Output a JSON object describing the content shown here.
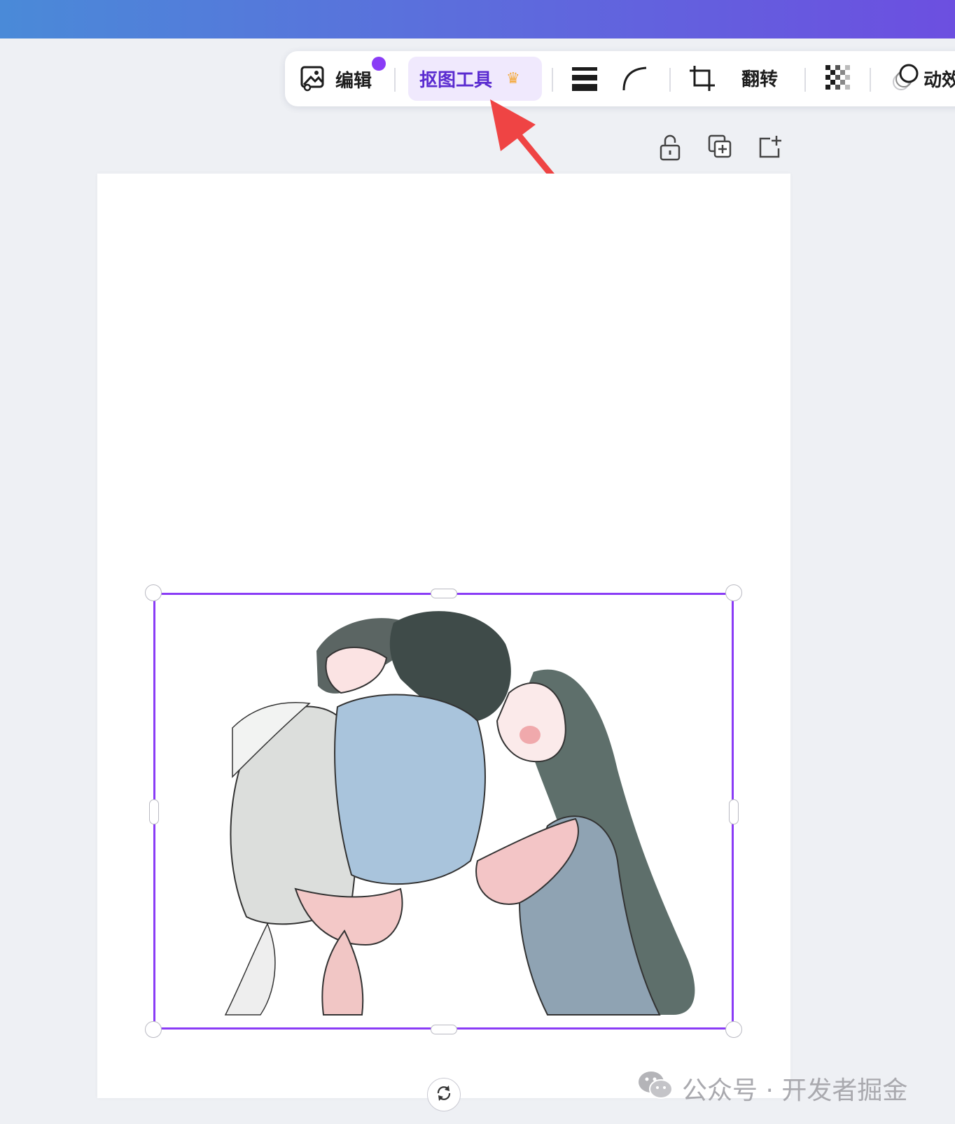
{
  "toolbar": {
    "edit_label": "编辑",
    "cutout_label": "抠图工具",
    "flip_label": "翻转",
    "animation_label": "动效"
  },
  "icons": {
    "edit": "image-edit-icon",
    "crown": "crown-icon",
    "line_spacing": "line-spacing-icon",
    "corner_radius": "corner-radius-icon",
    "crop": "crop-icon",
    "transparency": "transparency-icon",
    "animation": "animation-icon",
    "lock": "unlock-icon",
    "duplicate": "duplicate-icon",
    "add_page": "add-icon",
    "rotate": "rotate-icon"
  },
  "colors": {
    "accent": "#8a3cf6",
    "selected_tool_bg": "#f0e9fd",
    "selected_tool_text": "#5a2bd0",
    "arrow": "#ef4444",
    "crown": "#f4a93a"
  },
  "watermark": {
    "text": "公众号 · 开发者掘金"
  }
}
